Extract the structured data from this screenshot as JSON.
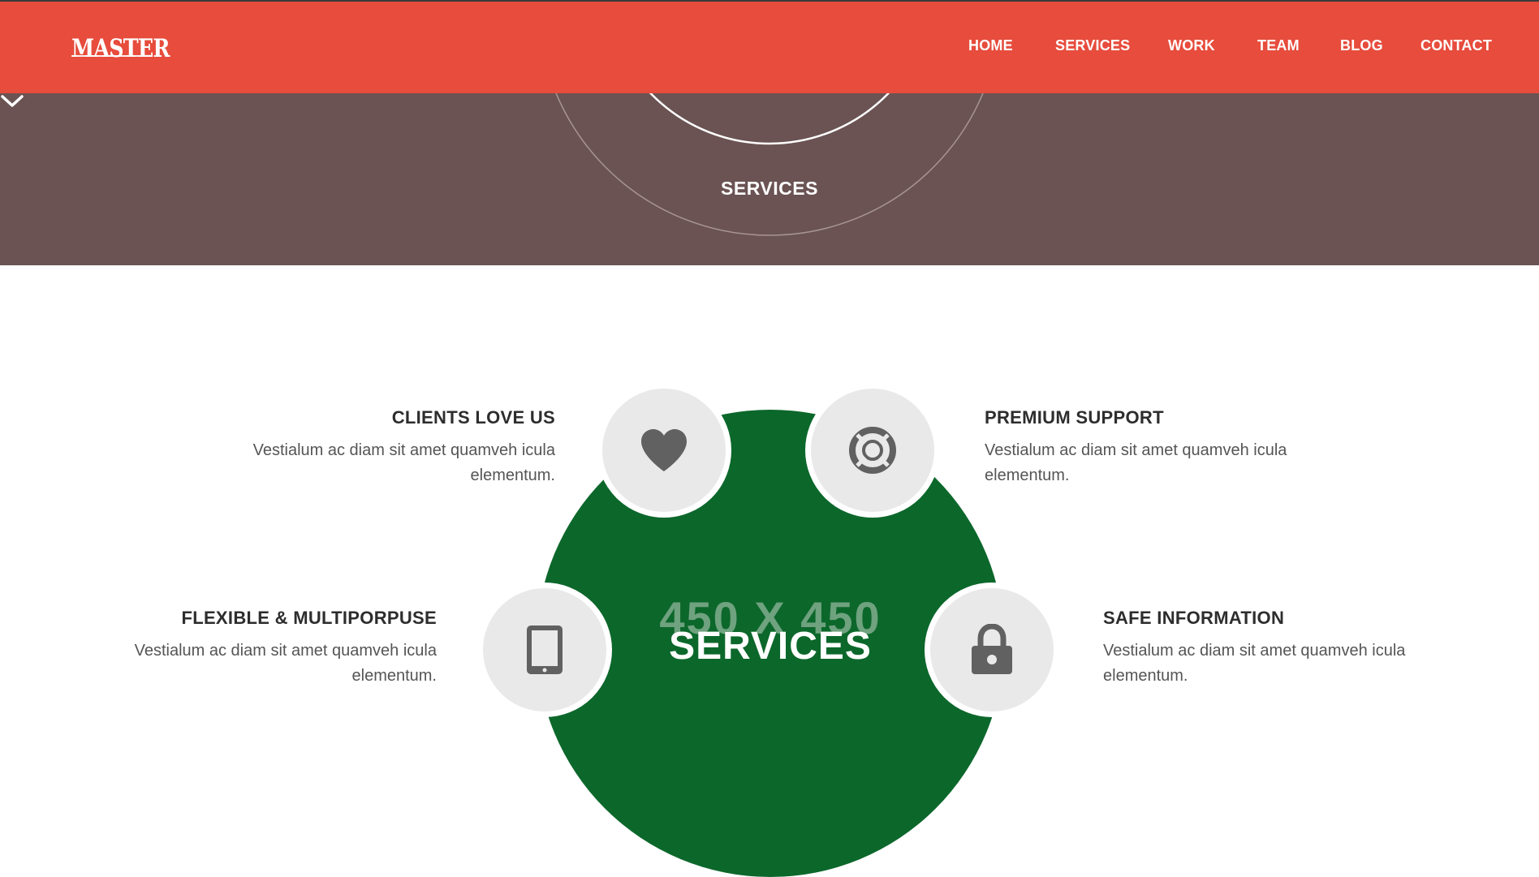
{
  "header": {
    "logo": "MASTER",
    "nav": [
      "HOME",
      "SERVICES",
      "WORK",
      "TEAM",
      "BLOG",
      "CONTACT"
    ],
    "bg_color": "#e74c3c"
  },
  "hero": {
    "title": "SERVICES",
    "bg_color": "#6b5353",
    "scroll_icon": "chevron-down-icon"
  },
  "services": {
    "placeholder_text": "450 X 450",
    "center_title": "SERVICES",
    "center_color": "#0c672b",
    "features": [
      {
        "title": "CLIENTS LOVE US",
        "text": "Vestialum ac diam sit amet quamveh icula elementum.",
        "icon": "heart-icon"
      },
      {
        "title": "PREMIUM SUPPORT",
        "text": "Vestialum ac diam sit amet quamveh icula elementum.",
        "icon": "lifebuoy-icon"
      },
      {
        "title": "FLEXIBLE & MULTIPORPUSE",
        "text": "Vestialum ac diam sit amet quamveh icula elementum.",
        "icon": "tablet-icon"
      },
      {
        "title": "SAFE INFORMATION",
        "text": "Vestialum ac diam sit amet quamveh icula elementum.",
        "icon": "lock-icon"
      }
    ]
  }
}
